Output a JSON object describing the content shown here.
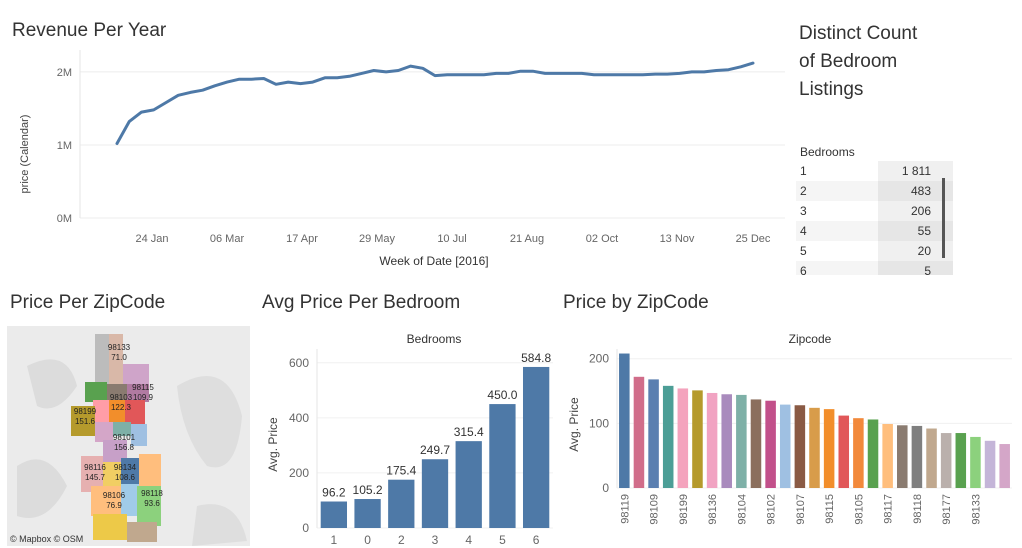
{
  "revenue_panel": {
    "title": "Revenue Per Year"
  },
  "distinct_panel": {
    "title": "Distinct Count of Bedroom Listings",
    "column_header": "Bedrooms",
    "rows": [
      {
        "bedrooms": "1",
        "count": "1 811"
      },
      {
        "bedrooms": "2",
        "count": "483"
      },
      {
        "bedrooms": "3",
        "count": "206"
      },
      {
        "bedrooms": "4",
        "count": "55"
      },
      {
        "bedrooms": "5",
        "count": "20"
      },
      {
        "bedrooms": "6",
        "count": "5"
      }
    ]
  },
  "map_panel": {
    "title": "Price Per ZipCode",
    "attribution": "© Mapbox © OSM",
    "labels": [
      {
        "zip": "98133",
        "value": "71.0"
      },
      {
        "zip": "98115",
        "value": "109.9"
      },
      {
        "zip": "98103",
        "value": "122.3"
      },
      {
        "zip": "98199",
        "value": "151.6"
      },
      {
        "zip": "98101",
        "value": "156.8"
      },
      {
        "zip": "98116",
        "value": "145.7"
      },
      {
        "zip": "98134",
        "value": "108.6"
      },
      {
        "zip": "98106",
        "value": "76.9"
      },
      {
        "zip": "98118",
        "value": "93.6"
      }
    ]
  },
  "bedroom_panel": {
    "title": "Avg Price Per Bedroom"
  },
  "zip_panel": {
    "title": "Price by ZipCode"
  },
  "chart_data": [
    {
      "type": "line",
      "title": "Revenue Per Year",
      "xlabel": "Week of Date [2016]",
      "ylabel": "price (Calendar)",
      "x_ticks": [
        "24 Jan",
        "06 Mar",
        "17 Apr",
        "29 May",
        "10 Jul",
        "21 Aug",
        "02 Oct",
        "13 Nov",
        "25 Dec"
      ],
      "y_ticks": [
        "0M",
        "1M",
        "2M"
      ],
      "ylim": [
        0,
        2300000
      ],
      "series_color": "#4e79a7",
      "series": [
        {
          "values": [
            1020000,
            1320000,
            1450000,
            1480000,
            1580000,
            1680000,
            1720000,
            1750000,
            1810000,
            1860000,
            1900000,
            1900000,
            1910000,
            1830000,
            1860000,
            1840000,
            1860000,
            1920000,
            1920000,
            1940000,
            1980000,
            2020000,
            2000000,
            2020000,
            2080000,
            2050000,
            1950000,
            1960000,
            1960000,
            1960000,
            1960000,
            1980000,
            1980000,
            2010000,
            2010000,
            1980000,
            1980000,
            1980000,
            1980000,
            1960000,
            1960000,
            1960000,
            1960000,
            1960000,
            1970000,
            1970000,
            1980000,
            2000000,
            2000000,
            2020000,
            2030000,
            2070000,
            2120000
          ]
        }
      ]
    },
    {
      "type": "bar",
      "title": "Avg Price Per Bedroom",
      "xlabel": "Bedrooms",
      "ylabel": "Avg. Price",
      "categories": [
        "1",
        "0",
        "2",
        "3",
        "4",
        "5",
        "6"
      ],
      "values": [
        96.2,
        105.2,
        175.4,
        249.7,
        315.4,
        450.0,
        584.8
      ],
      "data_labels": [
        "96.2",
        "105.2",
        "175.4",
        "249.7",
        "315.4",
        "450.0",
        "584.8"
      ],
      "y_ticks": [
        0,
        200,
        400,
        600
      ],
      "ylim": [
        0,
        650
      ],
      "bar_color": "#4e79a7"
    },
    {
      "type": "bar",
      "title": "Price by ZipCode",
      "xlabel": "Zipcode",
      "ylabel": "Avg. Price",
      "categories": [
        "98119",
        "",
        "98109",
        "",
        "98199",
        "",
        "98136",
        "",
        "98104",
        "",
        "98102",
        "",
        "98107",
        "",
        "98115",
        "",
        "98105",
        "",
        "98117",
        "",
        "98118",
        "",
        "98177",
        "",
        "98133",
        ""
      ],
      "values": [
        208,
        172,
        168,
        158,
        154,
        151,
        147,
        145,
        144,
        137,
        135,
        129,
        128,
        124,
        122,
        112,
        108,
        106,
        99,
        97,
        96,
        92,
        85,
        85,
        79,
        73,
        68
      ],
      "colors": [
        "#4e79a7",
        "#d16d8a",
        "#5b7fb0",
        "#4c9e96",
        "#f4a3bd",
        "#b59a2c",
        "#f1a3c2",
        "#a98bbd",
        "#7eb0a7",
        "#8b6f5d",
        "#c2508a",
        "#9fc0e2",
        "#8a5a44",
        "#d89c4a",
        "#f28e2b",
        "#e15759",
        "#f2893b",
        "#59a14f",
        "#ffbe7d",
        "#8a7b70",
        "#7f7f7f",
        "#c0a88e",
        "#bab0ac",
        "#59a14f",
        "#8cd17d",
        "#c4b5d8",
        "#d4a6c8"
      ],
      "y_ticks": [
        0,
        100,
        200
      ],
      "ylim": [
        0,
        215
      ]
    }
  ]
}
